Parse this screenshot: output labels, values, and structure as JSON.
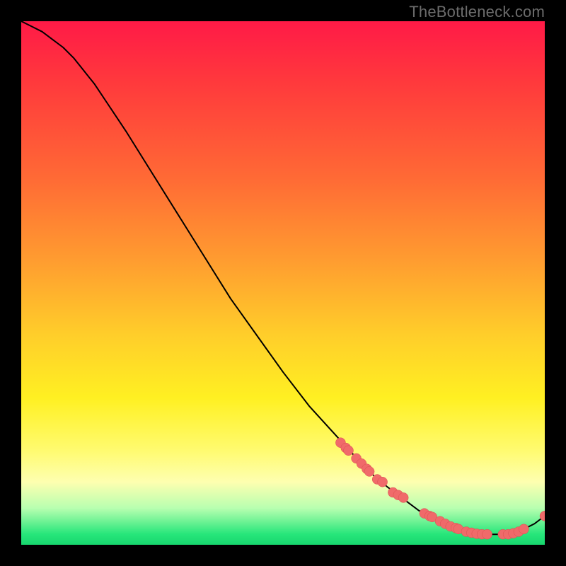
{
  "watermark": "TheBottleneck.com",
  "colors": {
    "line": "#000000",
    "dot_fill": "#f06a6a",
    "dot_stroke": "#d94f4f"
  },
  "chart_data": {
    "type": "line",
    "title": "",
    "xlabel": "",
    "ylabel": "",
    "xlim": [
      0,
      100
    ],
    "ylim": [
      0,
      100
    ],
    "grid": false,
    "legend": false,
    "series": [
      {
        "name": "bottleneck-curve",
        "x": [
          0,
          2,
          4,
          6,
          8,
          10,
          12,
          14,
          16,
          18,
          20,
          25,
          30,
          35,
          40,
          45,
          50,
          55,
          60,
          65,
          67,
          70,
          72,
          74,
          76,
          78,
          80,
          82,
          84,
          86,
          88,
          90,
          92,
          94,
          96,
          98,
          100
        ],
        "y": [
          100,
          99,
          98,
          96.5,
          95,
          93,
          90.5,
          88,
          85,
          82,
          79,
          71,
          63,
          55,
          47,
          40,
          33,
          26.5,
          21,
          15.5,
          13.5,
          11,
          9.5,
          8,
          6.5,
          5.5,
          4.5,
          3.5,
          2.8,
          2.3,
          2,
          2,
          2,
          2.3,
          3,
          4,
          5.5
        ]
      }
    ],
    "scatter_points": {
      "x": [
        61,
        62,
        62.5,
        64,
        65,
        66,
        66.5,
        68,
        69,
        71,
        72,
        73,
        77,
        78,
        78.5,
        80,
        81,
        82,
        83,
        83.5,
        85,
        86,
        87,
        88,
        89,
        92,
        93,
        94,
        95,
        96,
        100
      ],
      "y": [
        19.5,
        18.5,
        18,
        16.5,
        15.5,
        14.5,
        14,
        12.5,
        12,
        10,
        9.5,
        9,
        6,
        5.5,
        5.3,
        4.5,
        4,
        3.5,
        3.2,
        3,
        2.5,
        2.3,
        2.1,
        2,
        2,
        2,
        2,
        2.2,
        2.5,
        3,
        5.5
      ]
    }
  }
}
